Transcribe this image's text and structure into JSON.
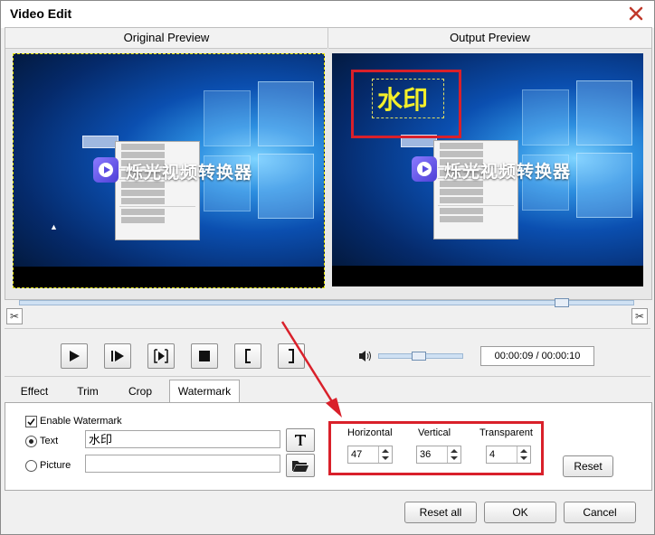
{
  "window": {
    "title": "Video Edit"
  },
  "preview": {
    "original_label": "Original Preview",
    "output_label": "Output Preview",
    "brand_text": "烁光视频转换器",
    "watermark_text": "水印"
  },
  "playback": {
    "time": "00:00:09 / 00:00:10",
    "volume_level": 0.35,
    "position": 0.88
  },
  "tabs": [
    {
      "label": "Effect"
    },
    {
      "label": "Trim"
    },
    {
      "label": "Crop"
    },
    {
      "label": "Watermark"
    }
  ],
  "watermark": {
    "enable_label": "Enable Watermark",
    "text_label": "Text",
    "text_value": "水印",
    "picture_label": "Picture",
    "picture_value": "",
    "horizontal_label": "Horizontal",
    "horizontal_value": "47",
    "vertical_label": "Vertical",
    "vertical_value": "36",
    "transparent_label": "Transparent",
    "transparent_value": "4",
    "reset_label": "Reset"
  },
  "footer": {
    "reset_all_label": "Reset all",
    "ok_label": "OK",
    "cancel_label": "Cancel"
  },
  "colors": {
    "accent_red": "#d9202a",
    "watermark_yellow": "#f4ef2a"
  }
}
